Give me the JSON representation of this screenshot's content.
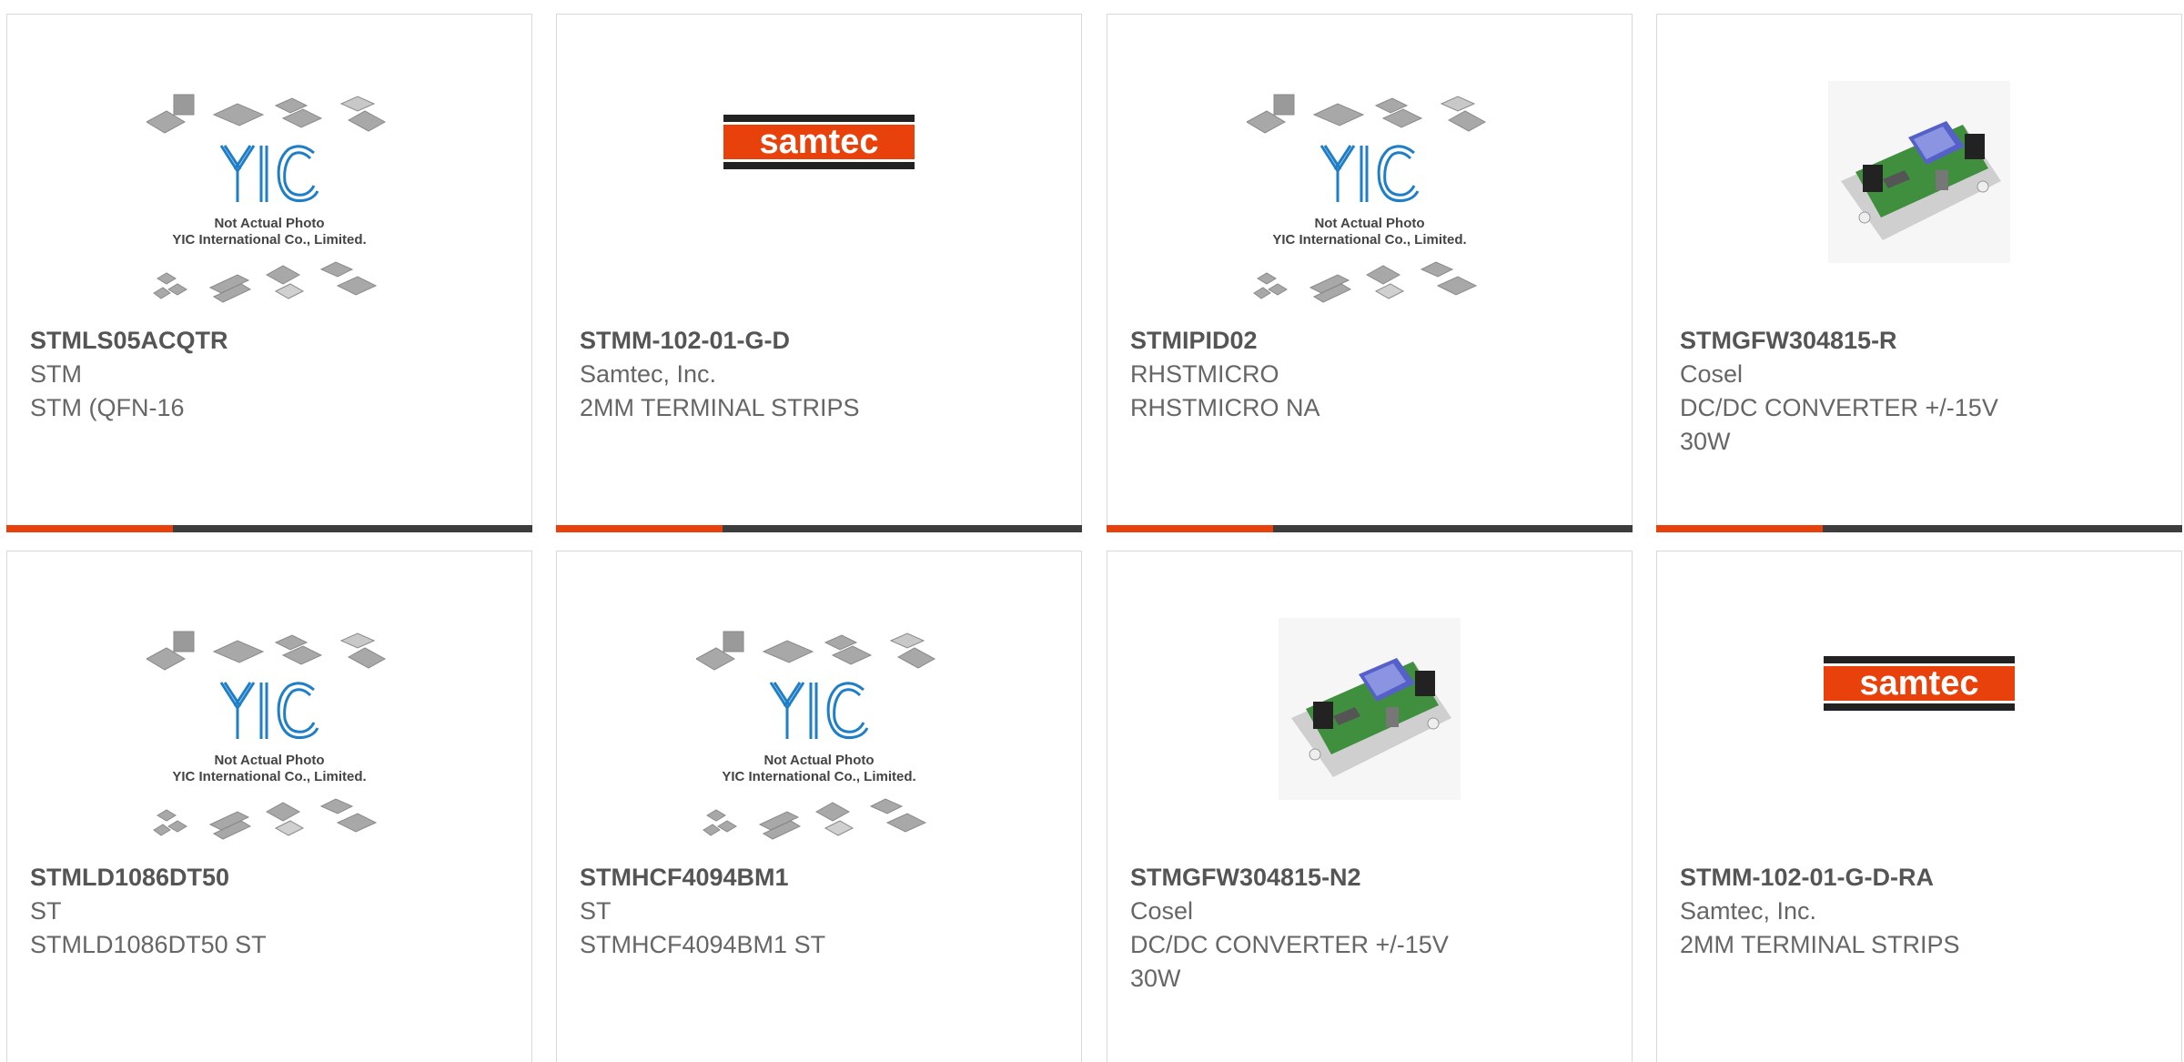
{
  "colors": {
    "accent": "#e8410b",
    "bar_dark": "#3d3d3d",
    "border": "#d9d9d9",
    "yic_blue": "#1e7ec8",
    "samtec_orange": "#e8410b"
  },
  "products": [
    {
      "part_number": "STMLS05ACQTR",
      "manufacturer": "STM",
      "description": "STM (QFN-16",
      "image": "yic-placeholder"
    },
    {
      "part_number": "STMM-102-01-G-D",
      "manufacturer": "Samtec, Inc.",
      "description": "2MM TERMINAL STRIPS",
      "image": "samtec-logo"
    },
    {
      "part_number": "STMIPID02",
      "manufacturer": "RHSTMICRO",
      "description": "RHSTMICRO NA",
      "image": "yic-placeholder"
    },
    {
      "part_number": "STMGFW304815-R",
      "manufacturer": "Cosel",
      "description": "DC/DC CONVERTER +/-15V 30W",
      "image": "pcb-board"
    },
    {
      "part_number": "STMLD1086DT50",
      "manufacturer": "ST",
      "description": "STMLD1086DT50 ST",
      "image": "yic-placeholder"
    },
    {
      "part_number": "STMHCF4094BM1",
      "manufacturer": "ST",
      "description": "STMHCF4094BM1 ST",
      "image": "yic-placeholder"
    },
    {
      "part_number": "STMGFW304815-N2",
      "manufacturer": "Cosel",
      "description": "DC/DC CONVERTER +/-15V 30W",
      "image": "pcb-board"
    },
    {
      "part_number": "STMM-102-01-G-D-RA",
      "manufacturer": "Samtec, Inc.",
      "description": "2MM TERMINAL STRIPS",
      "image": "samtec-logo"
    }
  ],
  "placeholder": {
    "logo_text": "YIC",
    "line1": "Not Actual Photo",
    "line2": "YIC International Co., Limited."
  },
  "samtec": {
    "logo_text": "samtec"
  }
}
